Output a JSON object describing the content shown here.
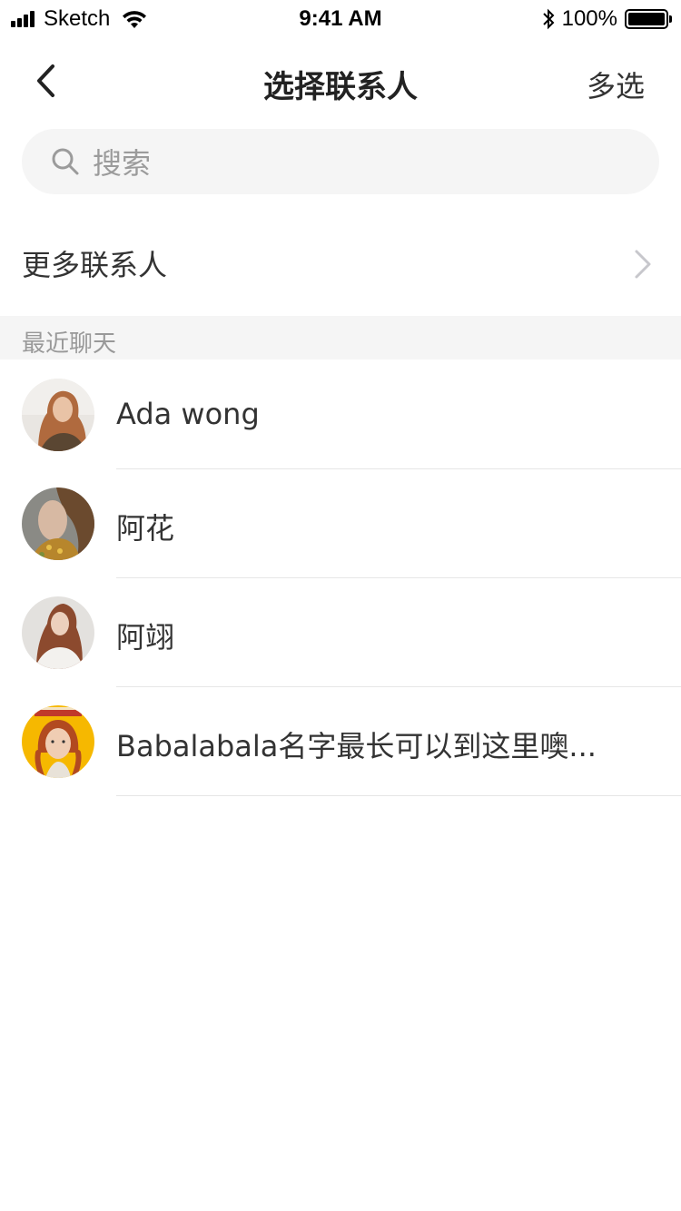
{
  "status_bar": {
    "carrier": "Sketch",
    "time": "9:41 AM",
    "battery": "100%"
  },
  "nav": {
    "title": "选择联系人",
    "action": "多选",
    "back_icon": "chevron-left-icon"
  },
  "search": {
    "placeholder": "搜索",
    "icon": "search-icon"
  },
  "more_contacts": {
    "label": "更多联系人",
    "icon": "chevron-right-icon"
  },
  "section": {
    "label": "最近聊天"
  },
  "contacts": [
    {
      "name": "Ada wong"
    },
    {
      "name": "阿花"
    },
    {
      "name": "阿翊"
    },
    {
      "name": "Babalabala名字最长可以到这里噢..."
    }
  ],
  "colors": {
    "background": "#ffffff",
    "search_bg": "#f5f5f5",
    "section_bg": "#f5f5f5",
    "text_primary": "#333333",
    "text_secondary": "#999999",
    "divider": "#e6e6e6"
  }
}
